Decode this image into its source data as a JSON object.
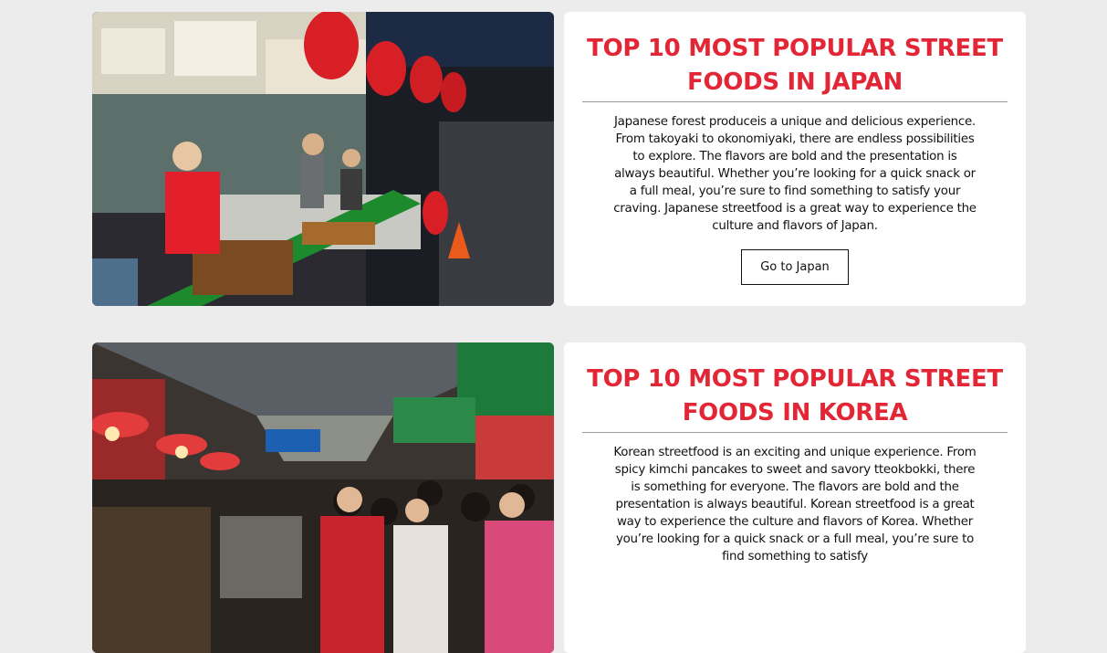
{
  "articles": [
    {
      "title": "TOP 10 MOST POPULAR STREET FOODS IN JAPAN",
      "body": "Japanese forest produceis a unique and delicious experience. From takoyaki to okonomiyaki, there are endless possibilities to explore. The flavors are bold and the presentation is always beautiful. Whether you’re looking for a quick snack or a full meal, you’re sure to find something to satisfy your craving. Japanese streetfood is a great way to experience the culture and flavors of Japan.",
      "button_label": "Go to Japan"
    },
    {
      "title": "TOP 10 MOST POPULAR STREET FOODS IN KOREA",
      "body": "Korean streetfood is an exciting and unique experience. From spicy kimchi pancakes to sweet and savory tteokbokki, there is something for everyone. The flavors are bold and the presentation is always beautiful. Korean streetfood is a great way to experience the culture and flavors of Korea. Whether you’re looking for a quick snack or a full meal, you’re sure to find something to satisfy"
    }
  ],
  "colors": {
    "page_background": "#ececec",
    "card_background": "#ffffff",
    "title_red": "#e32636"
  }
}
